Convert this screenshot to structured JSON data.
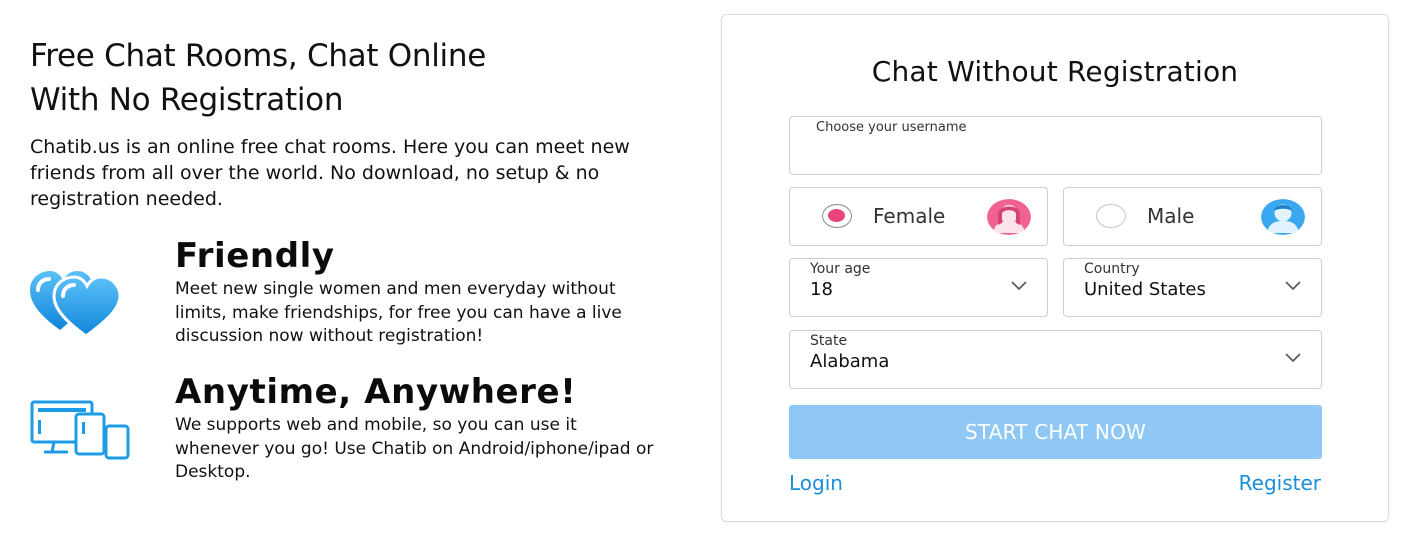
{
  "intro": {
    "title_line1": "Free Chat Rooms, Chat Online",
    "title_line2": "With No Registration",
    "description": "Chatib.us is an online free chat rooms. Here you can meet new friends from all over the world. No download, no setup & no registration needed."
  },
  "features": [
    {
      "icon": "hearts-icon",
      "title": "Friendly",
      "text": "Meet new single women and men everyday without limits, make friendships, for free you can have a live discussion now without registration!"
    },
    {
      "icon": "devices-icon",
      "title": "Anytime, Anywhere!",
      "text": "We supports web and mobile, so you can use it whenever you go! Use Chatib on Android/iphone/ipad or Desktop."
    }
  ],
  "form": {
    "title": "Chat Without Registration",
    "username_label": "Choose your username",
    "username_value": "",
    "gender": {
      "female_label": "Female",
      "male_label": "Male",
      "selected": "Female"
    },
    "age": {
      "label": "Your age",
      "value": "18"
    },
    "country": {
      "label": "Country",
      "value": "United States"
    },
    "state": {
      "label": "State",
      "value": "Alabama"
    },
    "start_button": "START CHAT NOW",
    "login_link": "Login",
    "register_link": "Register"
  },
  "colors": {
    "accent_blue": "#1a8fd8",
    "button_disabled": "#90c8f5",
    "female_pink": "#e8457c",
    "icon_blue": "#1e9be6"
  }
}
